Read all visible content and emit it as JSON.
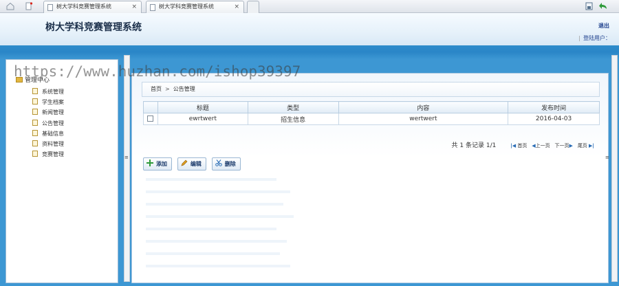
{
  "browser": {
    "tabs": [
      {
        "label": "树大学科竞赛管理系统",
        "close": "×"
      },
      {
        "label": "树大学科竞赛管理系统",
        "close": "×"
      }
    ]
  },
  "header": {
    "title": "树大学科竞赛管理系统",
    "exit_label": "退出",
    "login_user_label": "登陆用户："
  },
  "sidebar": {
    "root_label": "管理中心",
    "items": [
      {
        "label": "系统管理"
      },
      {
        "label": "学生档案"
      },
      {
        "label": "新闻管理"
      },
      {
        "label": "公告管理"
      },
      {
        "label": "基础信息"
      },
      {
        "label": "资料管理"
      },
      {
        "label": "竞赛管理"
      }
    ]
  },
  "breadcrumb": {
    "home": "首页",
    "separator": ">",
    "current": "公告管理"
  },
  "table": {
    "columns": [
      "标题",
      "类型",
      "内容",
      "发布时间"
    ],
    "rows": [
      {
        "title": "ewrtwert",
        "type": "招生信息",
        "content": "wertwert",
        "date": "2016-04-03"
      }
    ]
  },
  "pager": {
    "info": "共 1 条记录 1/1",
    "first": "首页",
    "prev": "上一页",
    "next": "下一页",
    "last": "尾页"
  },
  "actions": {
    "add": "添加",
    "edit": "编辑",
    "delete": "删除"
  },
  "watermark": "https://www.huzhan.com/ishop39397",
  "colors": {
    "band": "#3d97d3",
    "header_text": "#1b2f4a",
    "link": "#1d3f8c"
  }
}
